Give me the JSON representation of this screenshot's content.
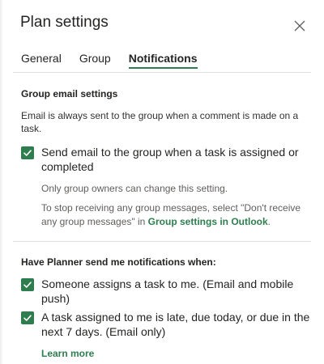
{
  "panel": {
    "title": "Plan settings",
    "close_icon": "close-icon"
  },
  "tabs": [
    {
      "label": "General",
      "active": false
    },
    {
      "label": "Group",
      "active": false
    },
    {
      "label": "Notifications",
      "active": true
    }
  ],
  "group_email": {
    "heading": "Group email settings",
    "description": "Email is always sent to the group when a comment is made on a task.",
    "checkbox_label": "Send email to the group when a task is assigned or completed",
    "checkbox_checked": true,
    "owner_note": "Only group owners can change this setting.",
    "stop_note_prefix": "To stop receiving any group messages, select \"Don't receive any group messages\" in ",
    "stop_note_link": "Group settings in Outlook",
    "stop_note_suffix": "."
  },
  "notifications": {
    "heading": "Have Planner send me notifications when:",
    "items": [
      {
        "label": "Someone assigns a task to me. (Email and mobile push)",
        "checked": true
      },
      {
        "label": "A task assigned to me is late, due today, or due in the next 7 days. (Email only)",
        "checked": true
      }
    ],
    "learn_more": "Learn more"
  },
  "colors": {
    "accent": "#2e7d4f",
    "text": "#252423",
    "muted": "#605e5c"
  }
}
